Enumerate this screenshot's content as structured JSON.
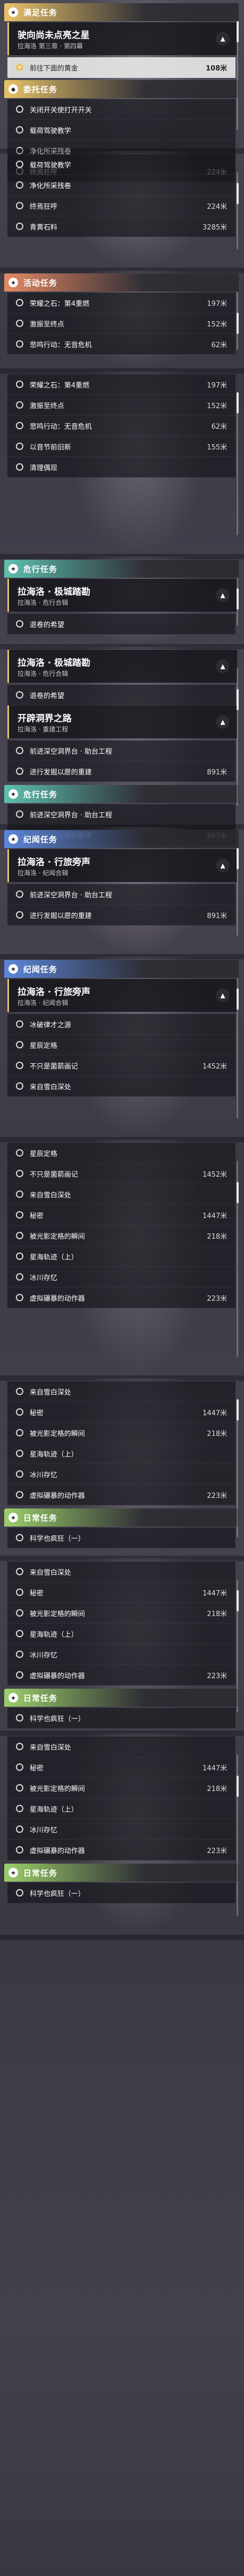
{
  "panels": [
    {
      "header": {
        "label": "满足任务",
        "icon": "star-icon",
        "color": "#e9c36a"
      },
      "quest": {
        "title": "驶向尚未点亮之星",
        "subtitle": "拉海洛 第三章 · 第四幕"
      },
      "items": [
        {
          "label": "前往下面的黄金",
          "distance": "108米",
          "selected": true
        }
      ],
      "subheader": {
        "label": "委托任务",
        "icon": "diamond-icon",
        "color": "#e9c36a"
      },
      "subitems": [
        {
          "label": "关闭开关使打开开关",
          "distance": ""
        },
        {
          "label": "载荷驾驶教学",
          "distance": ""
        },
        {
          "label": "净化所采残卷",
          "distance": ""
        },
        {
          "label": "终焉狂呼",
          "distance": "224米"
        }
      ]
    },
    {
      "items": [
        {
          "label": "载荷驾驶教学",
          "distance": ""
        },
        {
          "label": "净化所采残卷",
          "distance": ""
        },
        {
          "label": "终焉狂呼",
          "distance": "224米"
        },
        {
          "label": "青黄石料",
          "distance": "3285米"
        }
      ]
    },
    {
      "header": {
        "label": "活动任务",
        "icon": "star-icon",
        "color": "#e58a66"
      },
      "items": [
        {
          "label": "荣耀之石：第4重燃",
          "distance": "197米"
        },
        {
          "label": "激振至终点",
          "distance": "152米"
        },
        {
          "label": "悲鸣行动：无音危机",
          "distance": "62米"
        }
      ]
    },
    {
      "items": [
        {
          "label": "荣耀之石：第4重燃",
          "distance": "197米"
        },
        {
          "label": "激振至终点",
          "distance": "152米"
        },
        {
          "label": "悲鸣行动：无音危机",
          "distance": "62米"
        },
        {
          "label": "以音节前旧新",
          "distance": "155米"
        },
        {
          "label": "清理偶现",
          "distance": ""
        }
      ]
    },
    {
      "header": {
        "label": "危行任务",
        "icon": "star-icon",
        "color": "#5ec0b0"
      },
      "quest": {
        "title": "拉海洛 · 极城踏勘",
        "subtitle": "拉海洛 · 危行合辑"
      },
      "items": [
        {
          "label": "退卷的希望",
          "distance": ""
        }
      ]
    },
    {
      "header": {
        "label": "危行任务",
        "icon": "star-icon",
        "color": "#5ec0b0"
      },
      "quest": {
        "title": "拉海洛 · 极城踏勘",
        "subtitle": "拉海洛 · 危行合辑"
      },
      "items": [
        {
          "label": "退卷的希望",
          "distance": ""
        }
      ],
      "quest2": {
        "title": "开辟洞界之路",
        "subtitle": "拉海洛 · 重建工程"
      },
      "items2": [
        {
          "label": "前进深空洞界台 · 助台工程",
          "distance": ""
        },
        {
          "label": "进行发掘以愿的重建",
          "distance": "891米"
        }
      ]
    },
    {
      "header": {
        "label": "纪闻任务",
        "icon": "star-icon",
        "color": "#5b86d9"
      },
      "quest": {
        "title": "拉海洛 · 行旅旁声",
        "subtitle": "拉海洛 · 纪闻合辑"
      },
      "items": [
        {
          "label": "前进深空洞界台 · 助台工程",
          "distance": ""
        },
        {
          "label": "进行发掘以愿的重建",
          "distance": "891米"
        }
      ]
    },
    {
      "header": {
        "label": "纪闻任务",
        "icon": "star-icon",
        "color": "#5b86d9"
      },
      "quest": {
        "title": "拉海洛 · 行旅旁声",
        "subtitle": "拉海洛 · 纪闻合辑"
      },
      "items": [
        {
          "label": "冰破律才之源",
          "distance": ""
        },
        {
          "label": "星辰定格",
          "distance": ""
        },
        {
          "label": "不只是菌箭画记",
          "distance": "1452米"
        },
        {
          "label": "来自雪白深处",
          "distance": ""
        }
      ]
    },
    {
      "items": [
        {
          "label": "星辰定格",
          "distance": ""
        },
        {
          "label": "不只是菌箭画记",
          "distance": "1452米"
        },
        {
          "label": "来自雪白深处",
          "distance": ""
        },
        {
          "label": "秘密",
          "distance": "1447米"
        },
        {
          "label": "被光影定格的瞬间",
          "distance": "218米"
        },
        {
          "label": "星海轨迹（上）",
          "distance": ""
        },
        {
          "label": "冰川存忆",
          "distance": ""
        },
        {
          "label": "虚拟碾暴的动作器",
          "distance": "223米"
        }
      ]
    },
    {
      "items": [
        {
          "label": "来自雪白深处",
          "distance": ""
        },
        {
          "label": "秘密",
          "distance": "1447米"
        },
        {
          "label": "被光影定格的瞬间",
          "distance": "218米"
        },
        {
          "label": "星海轨迹（上）",
          "distance": ""
        },
        {
          "label": "冰川存忆",
          "distance": ""
        },
        {
          "label": "虚拟碾暴的动作器",
          "distance": "223米"
        }
      ],
      "header": {
        "label": "日常任务",
        "icon": "star-icon",
        "color": "#9ccf6b"
      },
      "items2": [
        {
          "label": "科学也疯狂（一）",
          "distance": ""
        }
      ]
    },
    {
      "items": [
        {
          "label": "来自雪白深处",
          "distance": ""
        },
        {
          "label": "秘密",
          "distance": "1447米"
        },
        {
          "label": "被光影定格的瞬间",
          "distance": "218米"
        },
        {
          "label": "星海轨迹（上）",
          "distance": ""
        },
        {
          "label": "冰川存忆",
          "distance": ""
        },
        {
          "label": "虚拟碾暴的动作器",
          "distance": "223米"
        }
      ],
      "header": {
        "label": "日常任务",
        "icon": "star-icon",
        "color": "#9ccf6b"
      },
      "items2": [
        {
          "label": "科学也疯狂（一）",
          "distance": ""
        }
      ]
    },
    {
      "items": [
        {
          "label": "来自雪白深处",
          "distance": ""
        },
        {
          "label": "秘密",
          "distance": "1447米"
        },
        {
          "label": "被光影定格的瞬间",
          "distance": "218米"
        },
        {
          "label": "星海轨迹（上）",
          "distance": ""
        },
        {
          "label": "冰川存忆",
          "distance": ""
        },
        {
          "label": "虚拟碾暴的动作器",
          "distance": "223米"
        }
      ],
      "header": {
        "label": "日常任务",
        "icon": "star-icon",
        "color": "#9ccf6b"
      },
      "items2": [
        {
          "label": "科学也疯狂（一）",
          "distance": ""
        }
      ]
    }
  ]
}
